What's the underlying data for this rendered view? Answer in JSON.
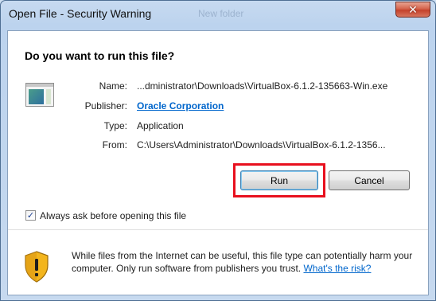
{
  "window": {
    "title": "Open File - Security Warning",
    "ghost_title": "New folder",
    "close_symbol": "✕"
  },
  "dialog": {
    "question": "Do you want to run this file?",
    "file_icon": "application-window-icon",
    "fields": {
      "name_label": "Name:",
      "name_value": "...dministrator\\Downloads\\VirtualBox-6.1.2-135663-Win.exe",
      "publisher_label": "Publisher:",
      "publisher_value": "Oracle Corporation",
      "type_label": "Type:",
      "type_value": "Application",
      "from_label": "From:",
      "from_value": "C:\\Users\\Administrator\\Downloads\\VirtualBox-6.1.2-1356..."
    },
    "buttons": {
      "run": "Run",
      "cancel": "Cancel"
    },
    "highlight_color": "#e8101e",
    "checkbox": {
      "checked": true,
      "label": "Always ask before opening this file"
    },
    "warning": {
      "icon": "security-shield-icon",
      "text": "While files from the Internet can be useful, this file type can potentially harm your computer. Only run software from publishers you trust.",
      "link": "What's the risk?"
    }
  }
}
